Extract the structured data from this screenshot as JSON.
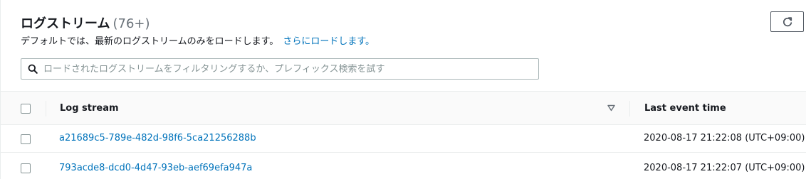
{
  "header": {
    "title": "ログストリーム",
    "count": "(76+)"
  },
  "description": {
    "text": "デフォルトでは、最新のログストリームのみをロードします。",
    "link": "さらにロードします。"
  },
  "search": {
    "placeholder": "ロードされたログストリームをフィルタリングするか、プレフィックス検索を試す"
  },
  "table": {
    "columns": {
      "log_stream": "Log stream",
      "last_event_time": "Last event time"
    },
    "rows": [
      {
        "stream": "a21689c5-789e-482d-98f6-5ca21256288b",
        "time": "2020-08-17 21:22:08 (UTC+09:00)"
      },
      {
        "stream": "793acde8-dcd0-4d47-93eb-aef69efa947a",
        "time": "2020-08-17 21:22:07 (UTC+09:00)"
      }
    ]
  },
  "icons": {
    "refresh": "refresh-icon",
    "search": "search-icon",
    "sort": "sort-descending-icon"
  },
  "colors": {
    "link": "#0073bb",
    "text": "#16191f",
    "placeholder": "#879596",
    "border": "#eaeded"
  }
}
